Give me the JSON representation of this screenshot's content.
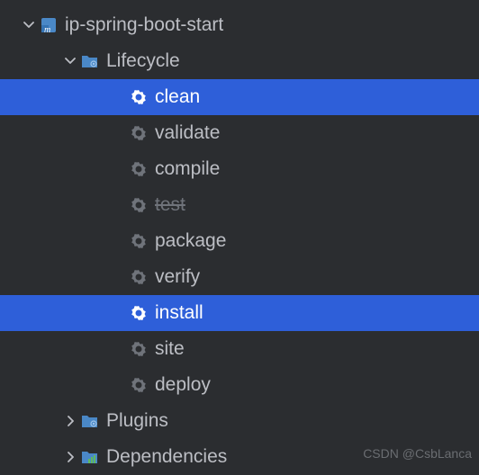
{
  "project": {
    "name": "ip-spring-boot-start"
  },
  "lifecycle": {
    "label": "Lifecycle",
    "goals": [
      {
        "name": "clean",
        "selected": true,
        "disabled": false
      },
      {
        "name": "validate",
        "selected": false,
        "disabled": false
      },
      {
        "name": "compile",
        "selected": false,
        "disabled": false
      },
      {
        "name": "test",
        "selected": false,
        "disabled": true
      },
      {
        "name": "package",
        "selected": false,
        "disabled": false
      },
      {
        "name": "verify",
        "selected": false,
        "disabled": false
      },
      {
        "name": "install",
        "selected": true,
        "disabled": false
      },
      {
        "name": "site",
        "selected": false,
        "disabled": false
      },
      {
        "name": "deploy",
        "selected": false,
        "disabled": false
      }
    ]
  },
  "plugins": {
    "label": "Plugins"
  },
  "dependencies": {
    "label": "Dependencies"
  },
  "watermark": "CSDN @CsbLanca"
}
